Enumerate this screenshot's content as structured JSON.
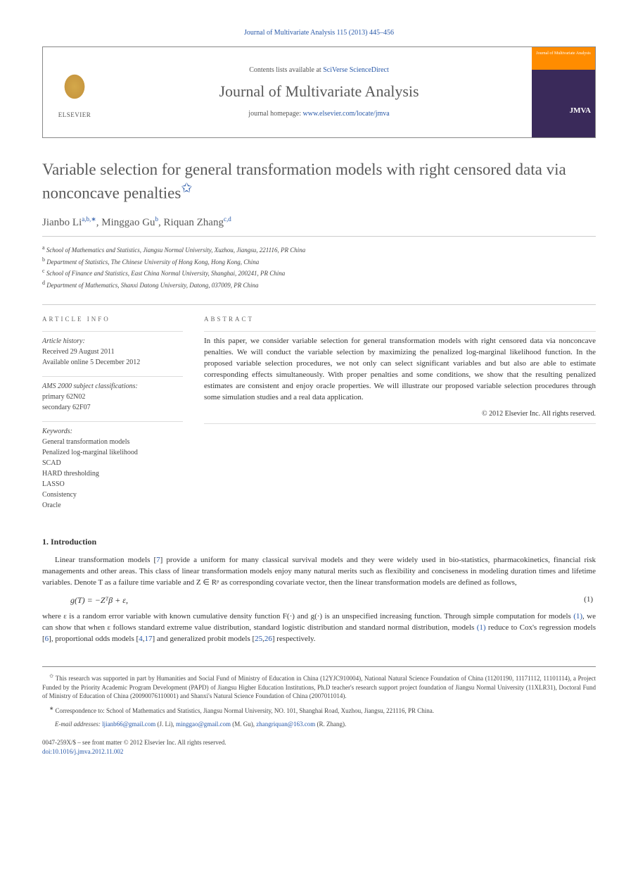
{
  "header": {
    "journal_ref": "Journal of Multivariate Analysis 115 (2013) 445–456",
    "contents_prefix": "Contents lists available at ",
    "contents_link": "SciVerse ScienceDirect",
    "journal_title": "Journal of Multivariate Analysis",
    "homepage_prefix": "journal homepage: ",
    "homepage_link": "www.elsevier.com/locate/jmva",
    "elsevier_label": "ELSEVIER",
    "cover_top": "Journal of Multivariate Analysis",
    "cover_abbrev": "JMVA"
  },
  "title": "Variable selection for general transformation models with right censored data via nonconcave penalties",
  "title_marker": "✩",
  "authors": {
    "a1_name": "Jianbo Li",
    "a1_aff": "a,b,",
    "a1_corr": "∗",
    "a2_name": "Minggao Gu",
    "a2_aff": "b",
    "a3_name": "Riquan Zhang",
    "a3_aff": "c,d"
  },
  "affiliations": {
    "a": "School of Mathematics and Statistics, Jiangsu Normal University, Xuzhou, Jiangsu, 221116, PR China",
    "b": "Department of Statistics, The Chinese University of Hong Kong, Hong Kong, China",
    "c": "School of Finance and Statistics, East China Normal University, Shanghai, 200241, PR China",
    "d": "Department of Mathematics, Shanxi Datong University, Datong, 037009, PR China"
  },
  "article_info": {
    "heading": "ARTICLE INFO",
    "history_label": "Article history:",
    "received": "Received 29 August 2011",
    "online": "Available online 5 December 2012",
    "ams_label": "AMS 2000 subject classifications:",
    "ams_primary": "primary 62N02",
    "ams_secondary": "secondary 62F07",
    "keywords_label": "Keywords:",
    "kw1": "General transformation models",
    "kw2": "Penalized log-marginal likelihood",
    "kw3": "SCAD",
    "kw4": "HARD thresholding",
    "kw5": "LASSO",
    "kw6": "Consistency",
    "kw7": "Oracle"
  },
  "abstract": {
    "heading": "ABSTRACT",
    "text": "In this paper, we consider variable selection for general transformation models with right censored data via nonconcave penalties. We will conduct the variable selection by maximizing the penalized log-marginal likelihood function. In the proposed variable selection procedures, we not only can select significant variables and but also are able to estimate corresponding effects simultaneously. With proper penalties and some conditions, we show that the resulting penalized estimates are consistent and enjoy oracle properties. We will illustrate our proposed variable selection procedures through some simulation studies and a real data application.",
    "copyright": "© 2012 Elsevier Inc. All rights reserved."
  },
  "section1": {
    "heading": "1.  Introduction",
    "p1_a": "Linear transformation models [",
    "p1_ref7": "7",
    "p1_b": "] provide a uniform for many classical survival models and they were widely used in bio-statistics, pharmacokinetics, financial risk managements and other areas. This class of linear transformation models enjoy many natural merits such as flexibility and conciseness in modeling duration times and lifetime variables. Denote T as a failure time variable and Z ∈ Rᵖ as corresponding covariate vector, then the linear transformation models are defined as follows,",
    "equation": "g(T) = −Zᵀβ + ε,",
    "eq_num": "(1)",
    "p2_a": "where ε is a random error variable with known cumulative density function F(·) and g(·) is an unspecified increasing function. Through simple computation for models ",
    "p2_ref1a": "(1)",
    "p2_b": ", we can show that when ε follows standard extreme value distribution, standard logistic distribution and standard normal distribution, models ",
    "p2_ref1b": "(1)",
    "p2_c": " reduce to Cox's regression models [",
    "p2_ref6": "6",
    "p2_d": "], proportional odds models [",
    "p2_ref4": "4",
    "p2_ref17": "17",
    "p2_e": "] and generalized probit models [",
    "p2_ref25": "25",
    "p2_ref26": "26",
    "p2_f": "] respectively."
  },
  "footnotes": {
    "funding": "This research was supported in part by Humanities and Social Fund of Ministry of Education in China (12YJC910004), National Natural Science Foundation of China (11201190, 11171112, 11101114), a Project Funded by the Priority Academic Program Development (PAPD) of Jiangsu Higher Education Institutions, Ph.D teacher's research support project foundation of Jiangsu Normal University (11XLR31), Doctoral Fund of Ministry of Education of China (20090076110001) and Shanxi's Natural Science Foundation of China (2007011014).",
    "corr_label": "Correspondence to: School of Mathematics and Statistics, Jiangsu Normal University, NO. 101, Shanghai Road, Xuzhou, Jiangsu, 221116, PR China.",
    "email_label": "E-mail addresses:",
    "email1": "ljianb66@gmail.com",
    "email1_who": " (J. Li), ",
    "email2": "minggao@gmail.com",
    "email2_who": " (M. Gu), ",
    "email3": "zhangriquan@163.com",
    "email3_who": " (R. Zhang)."
  },
  "footer": {
    "issn": "0047-259X/$ – see front matter © 2012 Elsevier Inc. All rights reserved.",
    "doi_label": "doi:",
    "doi": "10.1016/j.jmva.2012.11.002"
  }
}
